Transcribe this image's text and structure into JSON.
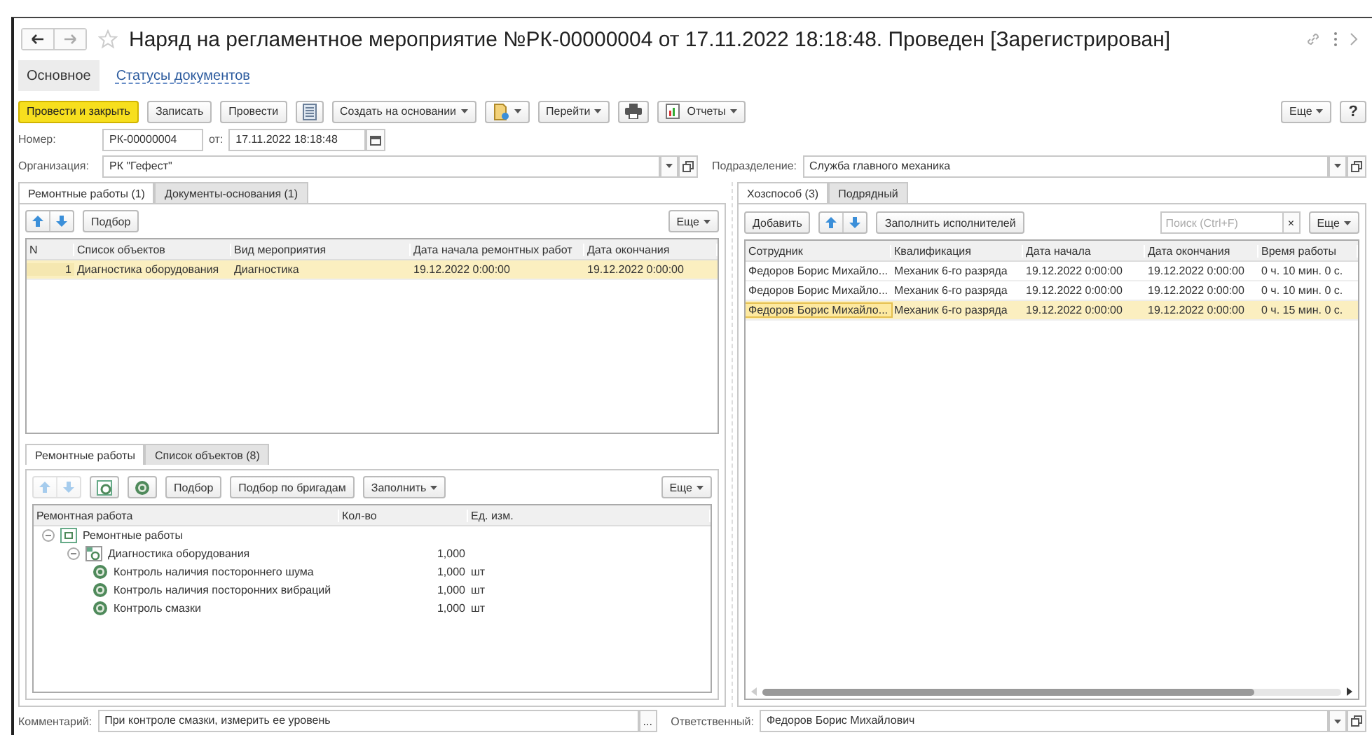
{
  "window": {
    "title": "Наряд на регламентное мероприятие №РК-00000004 от 17.11.2022 18:18:48. Проведен [Зарегистрирован]"
  },
  "sections": [
    {
      "label": "Основное",
      "selected": true
    },
    {
      "label": "Статусы документов",
      "selected": false
    }
  ],
  "toolbar": [
    {
      "kind": "primary",
      "label": "Провести и закрыть"
    },
    {
      "kind": "button",
      "label": "Записать"
    },
    {
      "kind": "button",
      "label": "Провести"
    },
    {
      "kind": "list"
    },
    {
      "kind": "dropdown",
      "label": "Создать на основании"
    },
    {
      "kind": "doc-dropdown"
    },
    {
      "kind": "dropdown",
      "label": "Перейти"
    },
    {
      "kind": "print"
    },
    {
      "kind": "report-dropdown",
      "label": "Отчеты"
    }
  ],
  "more_label": "Еще",
  "help_label": "?",
  "number": {
    "label": "Номер:",
    "value": "РК-00000004",
    "date_label": "от:",
    "date": "17.11.2022 18:18:48"
  },
  "organization": {
    "label": "Организация:",
    "value": "РК \"Гефест\""
  },
  "department": {
    "label": "Подразделение:",
    "value": "Служба главного механика"
  },
  "left_tabs": [
    {
      "label": "Ремонтные работы (1)",
      "selected": true
    },
    {
      "label": "Документы-основания (1)",
      "selected": false
    }
  ],
  "objects_toolbar": {
    "pick": "Подбор",
    "more": "Еще"
  },
  "objects_table": {
    "columns": [
      "N",
      "Список объектов",
      "Вид мероприятия",
      "Дата начала ремонтных работ",
      "Дата окончания"
    ],
    "rows": [
      {
        "selected": true,
        "cells": [
          "1",
          "Диагностика оборудования",
          "Диагностика",
          "19.12.2022 0:00:00",
          "19.12.2022 0:00:00"
        ]
      }
    ]
  },
  "lower_tabs": [
    {
      "label": "Ремонтные работы",
      "selected": true
    },
    {
      "label": "Список объектов (8)",
      "selected": false
    }
  ],
  "works_toolbar": {
    "buttons": [
      "Подбор",
      "Подбор по бригадам"
    ],
    "fill": "Заполнить",
    "more": "Еще"
  },
  "works_tree": {
    "columns": [
      "Ремонтная работа",
      "Кол-во",
      "Ед. изм."
    ],
    "nodes": [
      {
        "kind": "group",
        "label": "Ремонтные работы",
        "expanded": true,
        "children": [
          {
            "kind": "set",
            "label": "Диагностика оборудования",
            "qty": "1,000",
            "expanded": true,
            "children": [
              {
                "kind": "work",
                "label": "Контроль наличия постороннего шума",
                "qty": "1,000",
                "unit": "шт"
              },
              {
                "kind": "work",
                "label": "Контроль наличия посторонних вибраций",
                "qty": "1,000",
                "unit": "шт"
              },
              {
                "kind": "work",
                "label": "Контроль смазки",
                "qty": "1,000",
                "unit": "шт"
              }
            ]
          }
        ]
      }
    ]
  },
  "right_tabs": [
    {
      "label": "Хозспособ (3)",
      "selected": true
    },
    {
      "label": "Подрядный",
      "selected": false
    }
  ],
  "staff_toolbar": {
    "add": "Добавить",
    "fill": "Заполнить исполнителей",
    "search_placeholder": "Поиск (Ctrl+F)",
    "clear": "×",
    "more": "Еще"
  },
  "staff_table": {
    "columns": [
      "Сотрудник",
      "Квалификация",
      "Дата начала",
      "Дата окончания",
      "Время работы"
    ],
    "rows": [
      {
        "selected": false,
        "cells": [
          "Федоров Борис Михайло...",
          "Механик 6-го разряда",
          "19.12.2022 0:00:00",
          "19.12.2022 0:00:00",
          "0 ч. 10 мин. 0 с."
        ]
      },
      {
        "selected": false,
        "cells": [
          "Федоров Борис Михайло...",
          "Механик 6-го разряда",
          "19.12.2022 0:00:00",
          "19.12.2022 0:00:00",
          "0 ч. 10 мин. 0 с."
        ]
      },
      {
        "selected": true,
        "cells": [
          "Федоров Борис Михайло...",
          "Механик 6-го разряда",
          "19.12.2022 0:00:00",
          "19.12.2022 0:00:00",
          "0 ч. 15 мин. 0 с."
        ]
      }
    ]
  },
  "comment": {
    "label": "Комментарий:",
    "value": "При контроле смазки, измерить ее уровень",
    "button": "..."
  },
  "responsible": {
    "label": "Ответственный:",
    "value": "Федоров Борис Михайлович"
  }
}
